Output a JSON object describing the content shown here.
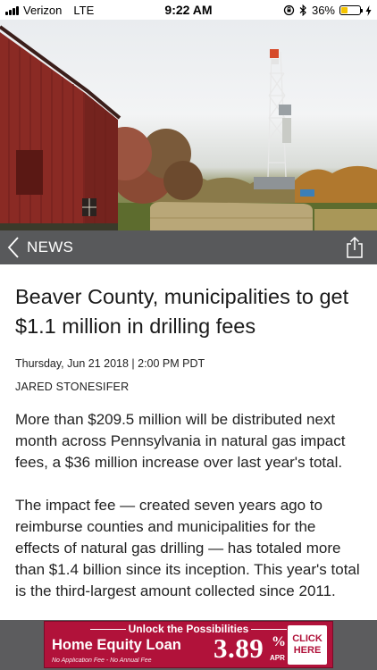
{
  "status_bar": {
    "carrier": "Verizon",
    "network": "LTE",
    "time": "9:22 AM",
    "battery": "36%",
    "battery_level": 0.36,
    "icons": [
      "signal-bars-icon",
      "orientation-lock-icon",
      "bluetooth-icon",
      "battery-icon",
      "charging-bolt-icon"
    ]
  },
  "hero": {
    "icon": "photo-barn-drilling-rig"
  },
  "nav": {
    "back_icon": "chevron-left-icon",
    "section_label": "NEWS",
    "share_icon": "share-icon"
  },
  "article": {
    "headline": "Beaver County, municipalities to get $1.1 million in drilling fees",
    "dateline": "Thursday, Jun 21 2018 | 2:00 PM PDT",
    "byline": "JARED STONESIFER",
    "paragraphs": [
      "More than $209.5 million will be distributed next month across Pennsylvania in natural gas impact fees, a $36 million increase over last year's total.",
      "The impact fee — created seven years ago to reimburse counties and municipalities for the effects of natural gas drilling — has totaled more than $1.4 billion since its inception. This year's total is the third-largest amount collected since 2011."
    ]
  },
  "ad": {
    "tagline": "Unlock the Possibilities",
    "title": "Home Equity Loan",
    "rate": "3.89",
    "percent": "%",
    "apr": "APR",
    "fine_print": "No Application Fee - No Annual Fee",
    "cta": "CLICK HERE",
    "brand_color": "#b1123a"
  }
}
